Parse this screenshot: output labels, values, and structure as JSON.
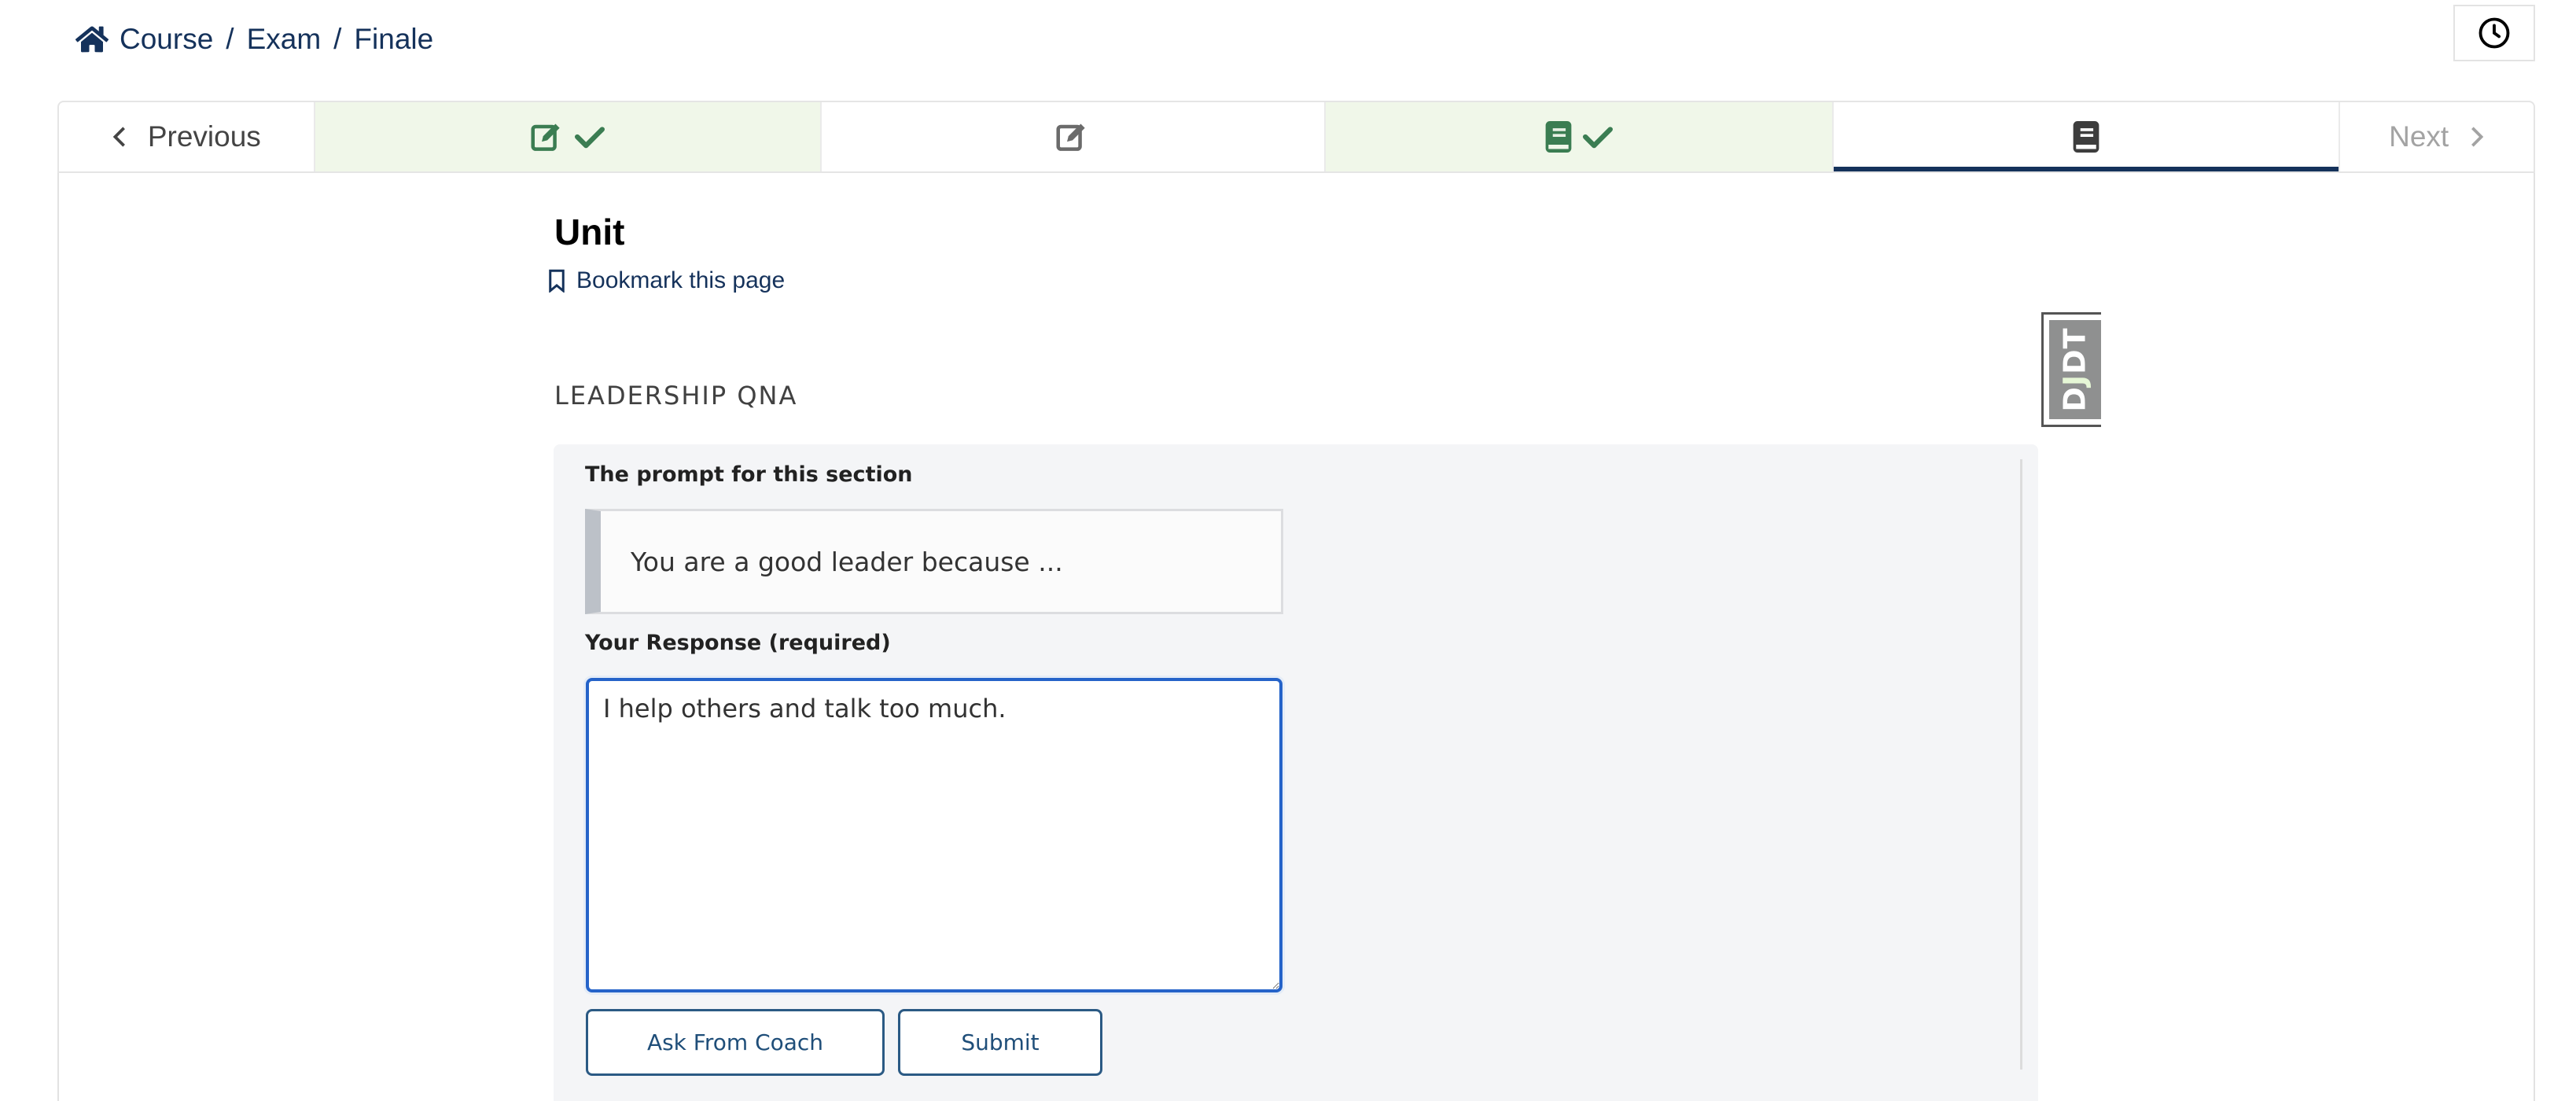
{
  "breadcrumb": {
    "items": [
      "Course",
      "Exam",
      "Finale"
    ],
    "separator": "/"
  },
  "header": {
    "clock_icon": "clock-icon",
    "home_icon": "home-icon"
  },
  "sequence_nav": {
    "previous_label": "Previous",
    "next_label": "Next",
    "units": [
      {
        "icons": [
          "edit-icon",
          "check-icon"
        ],
        "state": "completed"
      },
      {
        "icons": [
          "edit-icon"
        ],
        "state": "incomplete"
      },
      {
        "icons": [
          "book-icon",
          "check-icon"
        ],
        "state": "completed"
      },
      {
        "icons": [
          "book-icon"
        ],
        "state": "active"
      }
    ],
    "colors": {
      "completed_bg": "#f0f7e9",
      "completed_icon": "#3b7d52",
      "active_underline": "#15325b"
    }
  },
  "page": {
    "title": "Unit",
    "bookmark_label": "Bookmark this page"
  },
  "section": {
    "title": "LEADERSHIP QNA",
    "prompt_label": "The prompt for this section",
    "prompt_text": "You are a good leader because ...",
    "response_label": "Your Response (required)",
    "response_value": "I help others and talk too much.",
    "buttons": {
      "ask_coach": "Ask From Coach",
      "submit": "Submit"
    }
  },
  "debug_toolbar": {
    "handle_text_before": "D",
    "handle_text_j": "J",
    "handle_text_after": "DT"
  }
}
